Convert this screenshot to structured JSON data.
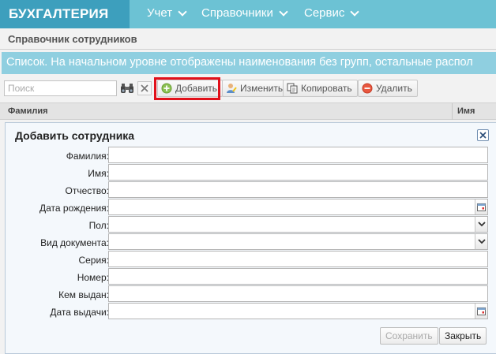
{
  "app": {
    "brand": "БУХГАЛТЕРИЯ"
  },
  "nav": [
    {
      "label": "Учет"
    },
    {
      "label": "Справочники"
    },
    {
      "label": "Сервис"
    }
  ],
  "page": {
    "title": "Справочник сотрудников",
    "info": "Список. На начальном уровне отображены наименования без групп, остальные распол"
  },
  "toolbar": {
    "search_placeholder": "Поиск",
    "add": "Добавить",
    "edit": "Изменить",
    "copy": "Копировать",
    "delete": "Удалить"
  },
  "grid": {
    "columns": [
      "Фамилия",
      "Имя"
    ]
  },
  "dialog": {
    "title": "Добавить сотрудника",
    "fields": [
      {
        "label": "Фамилия:",
        "value": ""
      },
      {
        "label": "Имя:",
        "value": ""
      },
      {
        "label": "Отчество:",
        "value": ""
      },
      {
        "label": "Дата рождения:",
        "value": ""
      },
      {
        "label": "Пол:",
        "value": ""
      },
      {
        "label": "Вид документа:",
        "value": ""
      },
      {
        "label": "Серия:",
        "value": ""
      },
      {
        "label": "Номер:",
        "value": ""
      },
      {
        "label": "Кем выдан:",
        "value": ""
      },
      {
        "label": "Дата выдачи:",
        "value": ""
      }
    ],
    "save": "Сохранить",
    "close": "Закрыть"
  },
  "colors": {
    "nav_bg": "#6cc2d4",
    "brand_bg": "#3d9fbd",
    "info_bg": "#8fcfe0",
    "highlight": "#e1101a"
  }
}
